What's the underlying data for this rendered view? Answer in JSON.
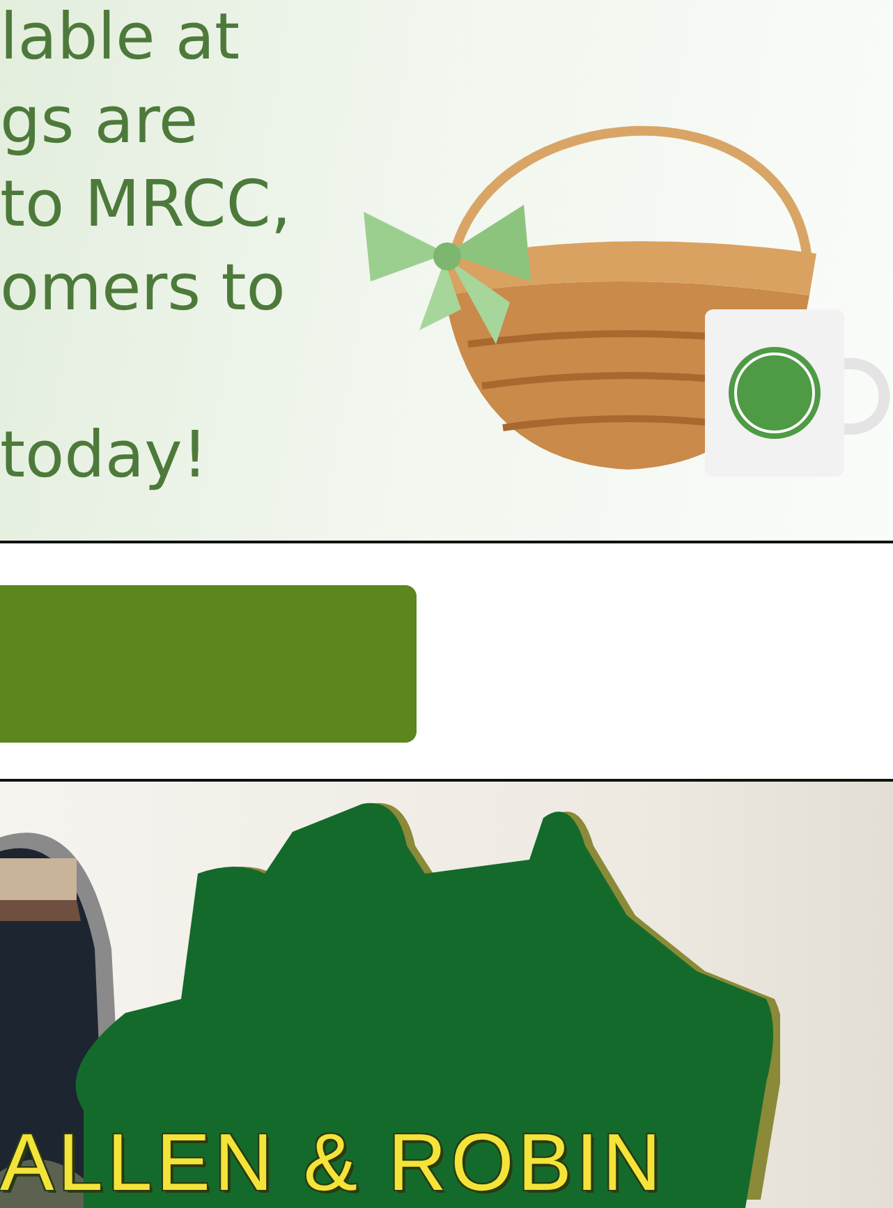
{
  "promo_banner": {
    "text": "lable at\ngs are\nto MRCC,\nomers to\n\ntoday!"
  },
  "event_banner": {
    "title": "ALLEN & ROBIN"
  }
}
